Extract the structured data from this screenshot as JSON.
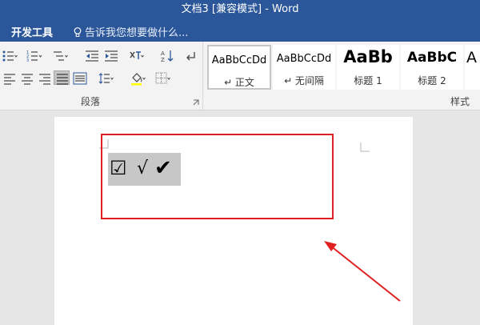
{
  "window": {
    "title": "文档3 [兼容模式] - Word"
  },
  "menubar": {
    "tab_developer": "开发工具",
    "tell_me": "告诉我您想要做什么..."
  },
  "ribbon": {
    "paragraph_group_label": "段落",
    "styles_group_label": "样式",
    "styles": [
      {
        "sample": "AaBbCcDd",
        "name": "↵ 正文"
      },
      {
        "sample": "AaBbCcDd",
        "name": "↵ 无间隔"
      },
      {
        "sample": "AaBb",
        "name": "标题 1"
      },
      {
        "sample": "AaBbC",
        "name": "标题 2"
      },
      {
        "sample": "A",
        "name": ""
      }
    ]
  },
  "document": {
    "symbols": [
      "☑",
      "√",
      "✔"
    ]
  },
  "colors": {
    "title_bar": "#2b579a",
    "annotation": "#e02020",
    "selection": "#c7c7c7"
  }
}
